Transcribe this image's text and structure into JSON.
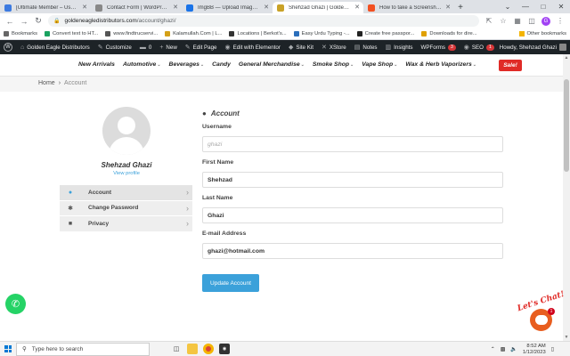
{
  "browser": {
    "tabs": [
      {
        "label": "[Ultimate Member – User Profi",
        "color": "#3c7ae0"
      },
      {
        "label": "Contact Form | WordPress.org",
        "color": "#888888"
      },
      {
        "label": "ImgBB — Upload Image — Fre",
        "color": "#1a73e8"
      },
      {
        "label": "Shehzad Ghazi | Golden Eagle D",
        "color": "#c9a227"
      },
      {
        "label": "How to take a Screenshot in W",
        "color": "#f25022"
      }
    ],
    "new_tab": "+",
    "url_host": "goldeneagledistributors.com",
    "url_path": "/account/ghazi/",
    "profile_initial": "G"
  },
  "bookmarks": {
    "items": [
      {
        "label": "Bookmarks",
        "color": "#666666"
      },
      {
        "label": "Convert text to HT...",
        "color": "#1aa260"
      },
      {
        "label": "www.findtrucservi...",
        "color": "#555555"
      },
      {
        "label": "Kalamullah.Com | L...",
        "color": "#d4a017"
      },
      {
        "label": "Locations | Berkot's...",
        "color": "#333333"
      },
      {
        "label": "Easy Urdu Typing -...",
        "color": "#2a6ebb"
      },
      {
        "label": "Create free passpor...",
        "color": "#222222"
      },
      {
        "label": "Downloads for dire...",
        "color": "#e0a000"
      }
    ],
    "other": "Other bookmarks"
  },
  "wp_admin": {
    "items": [
      {
        "icon": "home",
        "label": "Golden Eagle Distributors"
      },
      {
        "icon": "brush",
        "label": "Customize"
      },
      {
        "icon": "comment",
        "label": "0"
      },
      {
        "icon": "plus",
        "label": "New"
      },
      {
        "icon": "pencil",
        "label": "Edit Page"
      },
      {
        "icon": "elementor",
        "label": "Edit with Elementor"
      },
      {
        "icon": "kit",
        "label": "Site Kit"
      },
      {
        "icon": "x",
        "label": "XStore"
      },
      {
        "icon": "note",
        "label": "Notes"
      },
      {
        "icon": "chart",
        "label": "Insights"
      }
    ],
    "wpforms": "WPForms",
    "wpforms_count": "3",
    "seo": "SEO",
    "seo_count": "1",
    "howdy": "Howdy, Shehzad Ghazi"
  },
  "site_nav": {
    "items": [
      {
        "label": "New Arrivals",
        "dropdown": false
      },
      {
        "label": "Automotive",
        "dropdown": true
      },
      {
        "label": "Beverages",
        "dropdown": true
      },
      {
        "label": "Candy",
        "dropdown": false
      },
      {
        "label": "General Merchandise",
        "dropdown": true
      },
      {
        "label": "Smoke Shop",
        "dropdown": true
      },
      {
        "label": "Vape Shop",
        "dropdown": true
      },
      {
        "label": "Wax & Herb Vaporizers",
        "dropdown": true
      }
    ],
    "sale": "Sale!"
  },
  "breadcrumb": {
    "home": "Home",
    "separator": "›",
    "current": "Account"
  },
  "profile": {
    "name": "Shehzad Ghazi",
    "view_link": "View profile"
  },
  "account_nav": [
    {
      "label": "Account",
      "icon": "user-icon",
      "glyph": "●",
      "active": true
    },
    {
      "label": "Change Password",
      "icon": "asterisk-icon",
      "glyph": "✱",
      "active": false
    },
    {
      "label": "Privacy",
      "icon": "lock-icon",
      "glyph": "■",
      "active": false
    }
  ],
  "form": {
    "title": "Account",
    "username_label": "Username",
    "username_placeholder": "ghazi",
    "first_name_label": "First Name",
    "first_name_value": "Shehzad",
    "last_name_label": "Last Name",
    "last_name_value": "Ghazi",
    "email_label": "E-mail Address",
    "email_value": "ghazi@hotmail.com",
    "submit": "Update Account"
  },
  "widgets": {
    "chat_text": "Let's Chat!",
    "chat_badge": "1"
  },
  "taskbar": {
    "search_placeholder": "Type here to search",
    "time": "8:52 AM",
    "date": "1/12/2023"
  }
}
